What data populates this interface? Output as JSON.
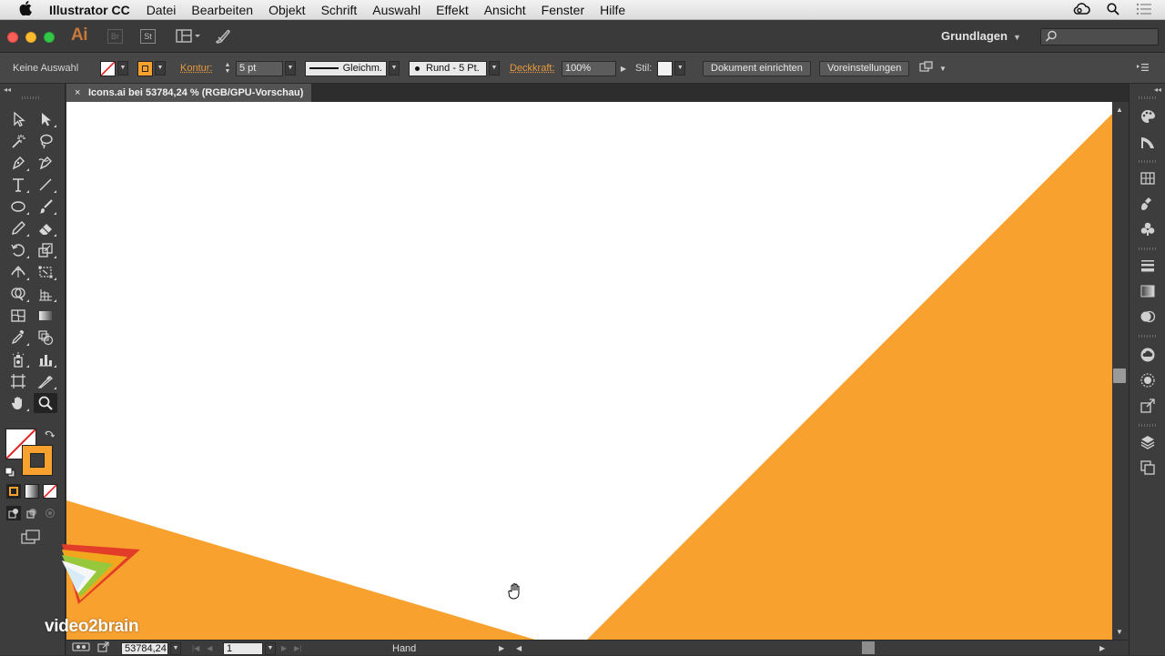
{
  "menubar": {
    "apple": "",
    "app_name": "Illustrator CC",
    "menus": [
      "Datei",
      "Bearbeiten",
      "Objekt",
      "Schrift",
      "Auswahl",
      "Effekt",
      "Ansicht",
      "Fenster",
      "Hilfe"
    ]
  },
  "appbar": {
    "logo": "Ai",
    "bridge_icon": "Br",
    "stock_icon": "St",
    "workspace": "Grundlagen",
    "search_placeholder": ""
  },
  "control": {
    "selection": "Keine Auswahl",
    "stroke_label": "Kontur:",
    "stroke_weight": "5 pt",
    "profile": "Gleichm.",
    "brush": "Rund - 5 Pt.",
    "opacity_label": "Deckkraft:",
    "opacity": "100%",
    "style_label": "Stil:",
    "doc_setup": "Dokument einrichten",
    "preferences": "Voreinstellungen"
  },
  "document": {
    "tab_close": "×",
    "tab_title": "Icons.ai bei 53784,24 % (RGB/GPU-Vorschau)"
  },
  "status": {
    "zoom": "53784,24",
    "artboard": "1",
    "tool": "Hand"
  },
  "colors": {
    "fill": "#f8a12f",
    "stroke": "none",
    "artwork": "#f8a12f",
    "accent_label": "#e79a3e"
  },
  "watermark": "video2brain"
}
